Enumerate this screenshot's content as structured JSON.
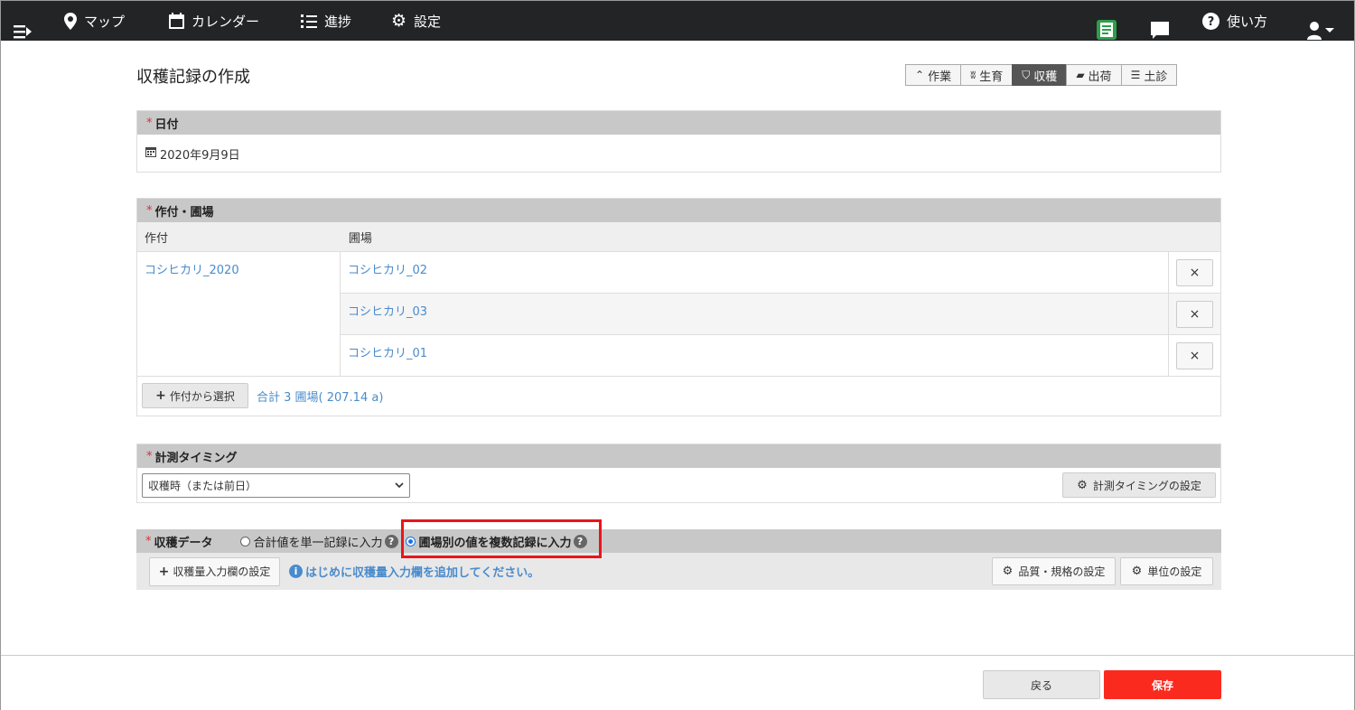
{
  "nav": {
    "map": "マップ",
    "calendar": "カレンダー",
    "progress": "進捗",
    "settings": "設定",
    "help": "使い方"
  },
  "page": {
    "title": "収穫記録の作成"
  },
  "type_tabs": [
    {
      "label": "作業",
      "icon": "sprout-arc-icon"
    },
    {
      "label": "生育",
      "icon": "grass-icon"
    },
    {
      "label": "収穫",
      "icon": "basket-icon",
      "active": true
    },
    {
      "label": "出荷",
      "icon": "truck-icon"
    },
    {
      "label": "土診",
      "icon": "sliders-icon"
    }
  ],
  "date_section": {
    "title": "日付",
    "value": "2020年9月9日"
  },
  "field_section": {
    "title": "作付・圃場",
    "col_crop": "作付",
    "col_field": "圃場",
    "crop": "コシヒカリ_2020",
    "fields": [
      "コシヒカリ_02",
      "コシヒカリ_03",
      "コシヒカリ_01"
    ],
    "delete_label": "×",
    "select_button": "作付から選択",
    "total": "合計 3 圃場( 207.14 a)"
  },
  "timing_section": {
    "title": "計測タイミング",
    "selected": "収穫時（または前日）",
    "settings_button": "計測タイミングの設定"
  },
  "harvest_section": {
    "title": "収穫データ",
    "option_single": "合計値を単一記録に入力",
    "option_multi": "圃場別の値を複数記録に入力",
    "add_button": "収穫量入力欄の設定",
    "info": "はじめに収穫量入力欄を追加してください。",
    "quality_button": "品質・規格の設定",
    "unit_button": "単位の設定"
  },
  "footer": {
    "back": "戻る",
    "save": "保存"
  },
  "colors": {
    "accent": "#fb2a1f",
    "link": "#4a8bcb",
    "highlight": "#e8151b"
  }
}
